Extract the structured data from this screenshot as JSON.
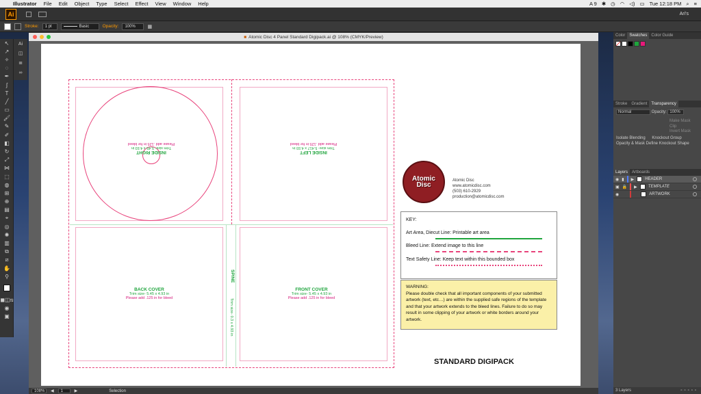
{
  "menubar": {
    "app": "Illustrator",
    "items": [
      "File",
      "Edit",
      "Object",
      "Type",
      "Select",
      "Effect",
      "View",
      "Window",
      "Help"
    ],
    "status_ai": "9",
    "clock": "Tue 12:18 PM"
  },
  "appbar": {
    "logo": "Ai",
    "user": "Ari's"
  },
  "control": {
    "stroke_label": "Stroke:",
    "stroke_value": "1 pt",
    "brush_value": "Basic",
    "opacity_label": "Opacity:",
    "opacity_value": "100%"
  },
  "document": {
    "title": "Atomic Disc 4 Panel Standard Digipack.ai @ 108% (CMYK/Preview)",
    "panels": {
      "inside_right": {
        "title": "INSIDE RIGHT",
        "trim": "Trim size- 5.45 x 4.93 in",
        "bleed": "Please add .125 in for bleed"
      },
      "inside_left": {
        "title": "INSIDE LEFT",
        "trim": "Trim size- 5.417 x 4.93 in",
        "bleed": "Please add .125 in for bleed"
      },
      "back_cover": {
        "title": "BACK COVER",
        "trim": "Trim size- 5.45 x 4.93 in",
        "bleed": "Please add .125 in for bleed"
      },
      "front_cover": {
        "title": "FRONT COVER",
        "trim": "Trim size- 5.45 x 4.93 in",
        "bleed": "Please add .125 in for bleed"
      },
      "spine": {
        "title": "SPINE",
        "trim": "Trim size- 0.3 x 4.93 in"
      }
    },
    "logo": {
      "line1": "Atomic",
      "line2": "Disc"
    },
    "contact": [
      "Atomic Disc",
      "www.atomicdisc.com",
      "(503) 610-2929",
      "production@atomicdisc.com"
    ],
    "key": {
      "heading": "KEY:",
      "art": "Art Area, Diecut Line: Printable art area",
      "bleed": "Bleed Line: Extend image to this line",
      "safety": "Text Safety Line: Keep text within this bounded box"
    },
    "warning": {
      "heading": "WARNING:",
      "body": "Please double check that all important components of your submitted artwork (text, etc…) are within the supplied safe regions of the template and that your artwork extends to the bleed lines. Failure to do so may result in some clipping of your artwork or white borders around your artwork."
    },
    "footer_title": "STANDARD DIGIPACK",
    "status": {
      "zoom": "108%",
      "page": "1",
      "tool": "Selection"
    }
  },
  "right_panel": {
    "color_tabs": [
      "Color",
      "Swatches",
      "Color Guide"
    ],
    "stroke_tabs": [
      "Stroke",
      "Gradient",
      "Transparency"
    ],
    "blend_mode": "Normal",
    "opacity_label": "Opacity:",
    "opacity_value": "100%",
    "make_mask": "Make Mask",
    "clip": "Clip",
    "invert_mask": "Invert Mask",
    "isolate": "Isolate Blending",
    "knockout": "Knockout Group",
    "opacity_mask": "Opacity & Mask Define Knockout Shape",
    "layer_tabs": [
      "Layers",
      "Artboards"
    ],
    "layers": [
      {
        "name": "HEADER",
        "color": "#4f7bff"
      },
      {
        "name": "TEMPLATE",
        "color": "#ff4f4f"
      },
      {
        "name": "ARTWORK",
        "color": "#d23b3b"
      }
    ],
    "layers_count": "3 Layers"
  },
  "colors": {
    "pink": "#e8417a",
    "green": "#1ea43c",
    "orange": "#ff9a00"
  }
}
